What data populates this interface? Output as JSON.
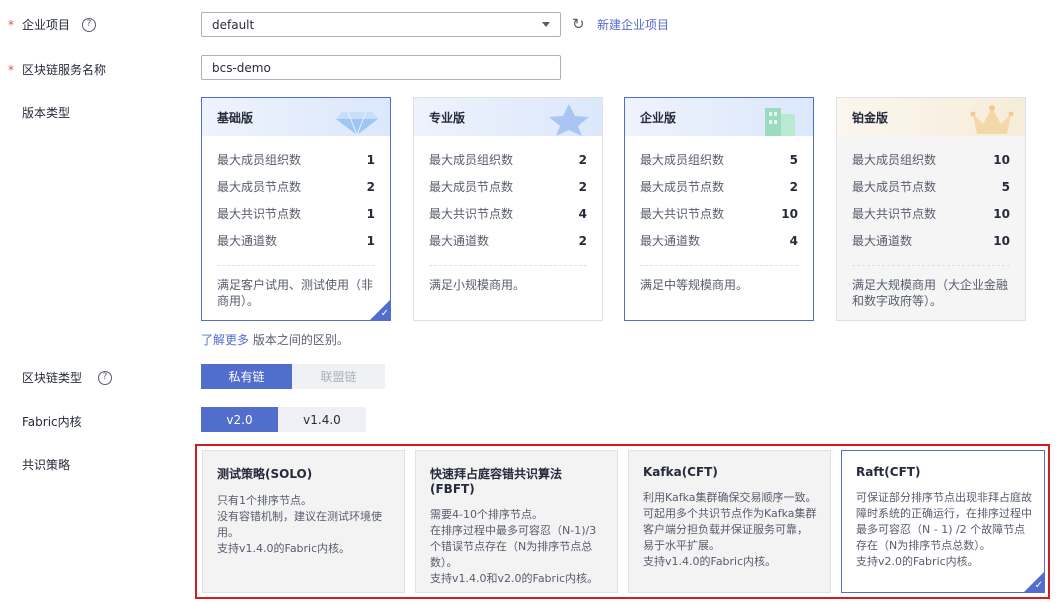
{
  "enterprise_project": {
    "label": "企业项目",
    "value": "default",
    "new_link": "新建企业项目"
  },
  "service_name": {
    "label": "区块链服务名称",
    "value": "bcs-demo"
  },
  "edition": {
    "label": "版本类型",
    "stats_labels": [
      "最大成员组织数",
      "最大成员节点数",
      "最大共识节点数",
      "最大通道数"
    ],
    "options": [
      {
        "name": "基础版",
        "values": [
          "1",
          "2",
          "1",
          "1"
        ],
        "desc": "满足客户试用、测试使用（非商用）。",
        "selected": true
      },
      {
        "name": "专业版",
        "values": [
          "2",
          "2",
          "4",
          "2"
        ],
        "desc": "满足小规模商用。",
        "selected": false
      },
      {
        "name": "企业版",
        "values": [
          "5",
          "2",
          "10",
          "4"
        ],
        "desc": "满足中等规模商用。",
        "selected": false
      },
      {
        "name": "铂金版",
        "values": [
          "10",
          "5",
          "10",
          "10"
        ],
        "desc": "满足大规模商用（大企业金融和数字政府等）。",
        "selected": false
      }
    ],
    "learn_more_link": "了解更多",
    "learn_more_text": " 版本之间的区别。"
  },
  "chain_type": {
    "label": "区块链类型",
    "options": [
      "私有链",
      "联盟链"
    ],
    "selected": "私有链"
  },
  "fabric": {
    "label": "Fabric内核",
    "options": [
      "v2.0",
      "v1.4.0"
    ],
    "selected": "v2.0"
  },
  "consensus": {
    "label": "共识策略",
    "options": [
      {
        "title": "测试策略(SOLO)",
        "desc": "只有1个排序节点。\n没有容错机制，建议在测试环境使用。\n支持v1.4.0的Fabric内核。",
        "selected": false
      },
      {
        "title": "快速拜占庭容错共识算法(FBFT)",
        "desc": "需要4-10个排序节点。\n在排序过程中最多可容忍（N-1)/3 个错误节点存在（N为排序节点总数）。\n支持v1.4.0和v2.0的Fabric内核。",
        "selected": false
      },
      {
        "title": "Kafka(CFT)",
        "desc": "利用Kafka集群确保交易顺序一致。\n可起用多个共识节点作为Kafka集群客户端分担负载并保证服务可靠，易于水平扩展。\n支持v1.4.0的Fabric内核。",
        "selected": false
      },
      {
        "title": "Raft(CFT)",
        "desc": "可保证部分排序节点出现非拜占庭故障时系统的正确运行，在排序过程中最多可容忍（N - 1) /2 个故障节点存在（N为排序节点总数）。\n支持v2.0的Fabric内核。",
        "selected": true
      }
    ]
  },
  "colors": {
    "accent": "#526ecc",
    "required": "#e44c4c",
    "highlight_border": "#d21e1e"
  }
}
